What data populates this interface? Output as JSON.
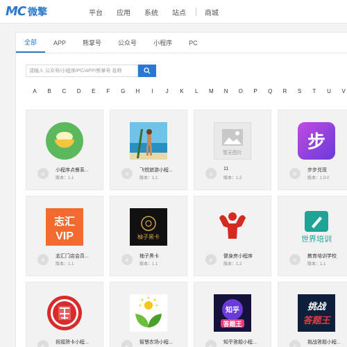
{
  "header": {
    "logo_mark": "MC",
    "logo_text": "微擎",
    "nav": [
      "平台",
      "应用",
      "系统",
      "站点",
      "商城"
    ]
  },
  "tabs": [
    "全部",
    "APP",
    "熊掌号",
    "公众号",
    "小程序",
    "PC"
  ],
  "active_tab": 0,
  "search": {
    "placeholder": "请输入 公众号/小程序/PC/APP/熊掌号 名称"
  },
  "alphabet": [
    "A",
    "B",
    "C",
    "D",
    "E",
    "F",
    "G",
    "H",
    "I",
    "J",
    "K",
    "L",
    "M",
    "N",
    "O",
    "P",
    "Q",
    "R",
    "S",
    "T",
    "U",
    "V"
  ],
  "colors": {
    "accent": "#2b78d0",
    "logo_red": "#e23c3c"
  },
  "apps": [
    {
      "name": "小程序点餐系...",
      "version": "版本：1.1",
      "icon": "bowl-icon"
    },
    {
      "name": "飞悦旅游小程...",
      "version": "版本：1.1",
      "icon": "beach-photo-icon"
    },
    {
      "name": "11",
      "version": "版本：1.2",
      "icon": "placeholder-image-icon",
      "icon_text": "暂无图片"
    },
    {
      "name": "步步兑现",
      "version": "版本：1.0.0",
      "icon": "step-icon",
      "icon_text": "步"
    },
    {
      "name": "志汇门店会员...",
      "version": "版本：1.1",
      "icon": "vip-icon",
      "icon_text": "志汇",
      "icon_text2": "VIP"
    },
    {
      "name": "柚子黑卡",
      "version": "版本：1.1",
      "icon": "youzi-card-icon",
      "icon_text": "柚子黑卡"
    },
    {
      "name": "健身房小程序",
      "version": "版本：1.2",
      "icon": "muscle-icon"
    },
    {
      "name": "教育培训学校",
      "version": "版本：1.1",
      "icon": "education-icon",
      "icon_text": "世界培训"
    },
    {
      "name": "祝福贺卡小程...",
      "version": "版本：1.1",
      "icon": "fu-paper-cut-icon"
    },
    {
      "name": "智慧农场小程...",
      "version": "版本：1.1",
      "icon": "farm-sprout-icon"
    },
    {
      "name": "知乎答题小程...",
      "version": "版本：1.1",
      "icon": "zhihu-quiz-icon",
      "icon_text": "知乎",
      "icon_text2": "答题王"
    },
    {
      "name": "挑战答题小程...",
      "version": "版本：1.1",
      "icon": "challenge-quiz-icon",
      "icon_text": "挑战",
      "icon_text2": "答题王"
    }
  ]
}
